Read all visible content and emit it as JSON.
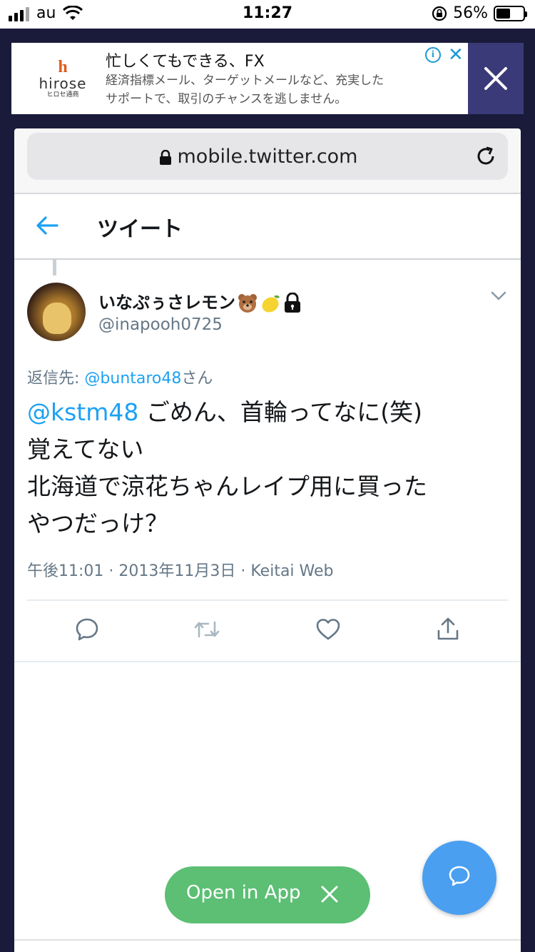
{
  "status_bar": {
    "carrier": "au",
    "time": "11:27",
    "battery": "56%",
    "battery_level": 0.56
  },
  "ad": {
    "logo_mark": "h",
    "logo_name": "hirose",
    "logo_sub": "ヒロセ通商",
    "title": "忙しくてもできる、FX",
    "desc_line1": "経済指標メール、ターゲットメールなど、充実した",
    "desc_line2": "サポートで、取引のチャンスを逃しません。",
    "info_glyph": "i",
    "close_glyph": "✕"
  },
  "browser": {
    "url": "mobile.twitter.com"
  },
  "header": {
    "title": "ツイート"
  },
  "tweet": {
    "display_name": "いなぷぅさレモン",
    "name_emojis": [
      "bear-icon",
      "lemon-icon",
      "lock-icon"
    ],
    "handle": "@inapooh0725",
    "reply_prefix": "返信先: ",
    "reply_to": "@buntaro48",
    "reply_suffix": "さん",
    "mention": "@kstm48",
    "text_line1": " ごめん、首輪ってなに(笑)",
    "text_line2": "覚えてない",
    "text_line3": "北海道で涼花ちゃんレイプ用に買った",
    "text_line4": "やつだっけ？",
    "meta": "午後11:01 · 2013年11月3日 · Keitai Web"
  },
  "open_in_app": {
    "label": "Open in App"
  },
  "colors": {
    "twitter_blue": "#1da1f2",
    "open_app_green": "#5cbf74",
    "fab_blue": "#4a9ff0",
    "ad_close_bg": "#3a3a78",
    "page_bg": "#1a1a3a"
  }
}
